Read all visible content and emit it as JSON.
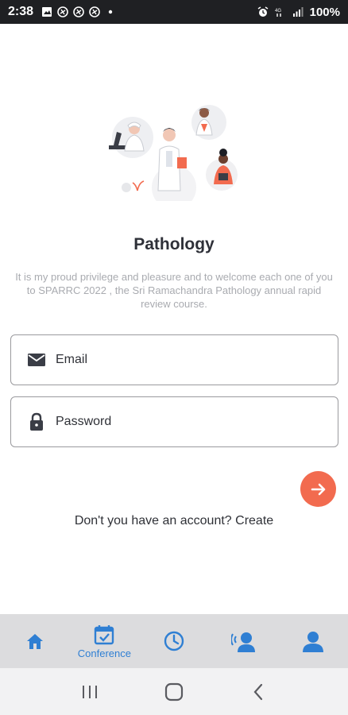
{
  "status_bar": {
    "time": "2:38",
    "battery": "100%",
    "left_icons": [
      "image-icon",
      "app-icon",
      "app-icon",
      "app-icon",
      "dot-icon"
    ],
    "right_icons": [
      "alarm-icon",
      "data-icon",
      "signal-icon"
    ]
  },
  "page": {
    "title": "Pathology",
    "description": "It is my proud privilege and pleasure and to welcome each one of you to SPARRC 2022 , the Sri Ramachandra Pathology annual rapid review course."
  },
  "form": {
    "email_placeholder": "Email",
    "password_placeholder": "Password",
    "submit_icon": "arrow-right-icon"
  },
  "signup": {
    "prompt": "Don't you have an account?",
    "link": "Create"
  },
  "bottom_nav": {
    "items": [
      {
        "icon": "home-icon",
        "label": ""
      },
      {
        "icon": "calendar-check-icon",
        "label": "Conference"
      },
      {
        "icon": "clock-icon",
        "label": ""
      },
      {
        "icon": "speaker-icon",
        "label": ""
      },
      {
        "icon": "user-icon",
        "label": ""
      }
    ]
  },
  "colors": {
    "accent": "#f26b4f",
    "nav_blue": "#2f7fd3",
    "title": "#2e3038",
    "description": "#a9abb0"
  }
}
